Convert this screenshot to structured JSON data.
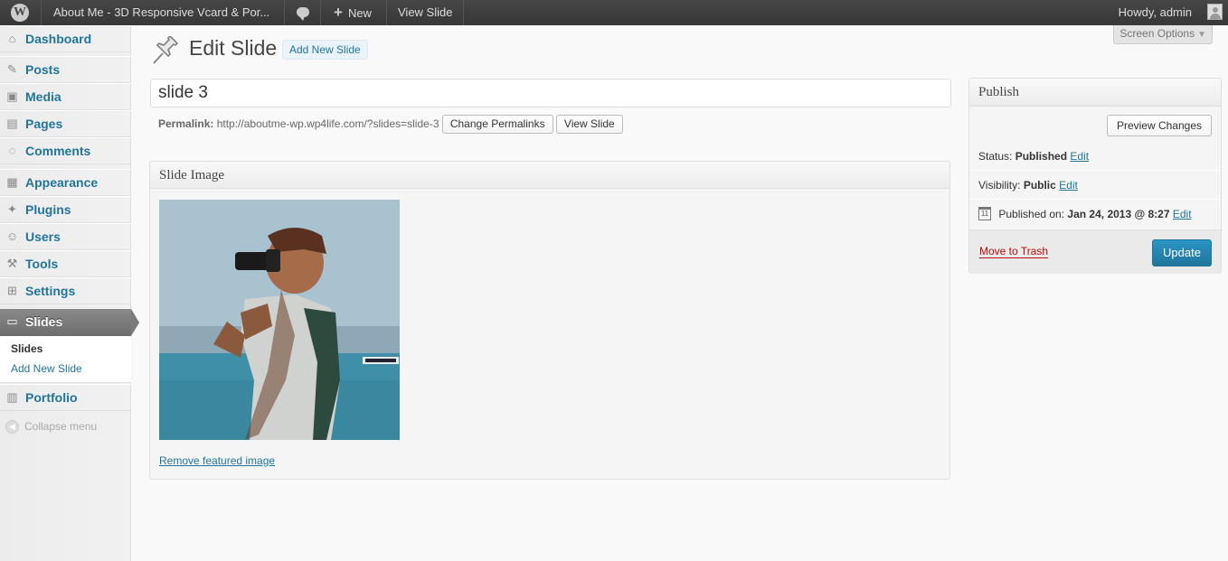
{
  "admin_bar": {
    "site_name": "About Me - 3D Responsive Vcard & Por...",
    "new_label": "New",
    "view_label": "View Slide",
    "howdy": "Howdy, admin"
  },
  "sidebar": {
    "items": [
      {
        "label": "Dashboard",
        "icon": "dashboard-icon"
      },
      {
        "label": "Posts",
        "icon": "pushpin-icon"
      },
      {
        "label": "Media",
        "icon": "media-icon"
      },
      {
        "label": "Pages",
        "icon": "pages-icon"
      },
      {
        "label": "Comments",
        "icon": "comments-icon"
      },
      {
        "label": "Appearance",
        "icon": "appearance-icon"
      },
      {
        "label": "Plugins",
        "icon": "plugins-icon"
      },
      {
        "label": "Users",
        "icon": "users-icon"
      },
      {
        "label": "Tools",
        "icon": "tools-icon"
      },
      {
        "label": "Settings",
        "icon": "settings-icon"
      },
      {
        "label": "Slides",
        "icon": "slides-icon"
      },
      {
        "label": "Portfolio",
        "icon": "portfolio-icon"
      }
    ],
    "submenu": {
      "current": "Slides",
      "add_new": "Add New Slide"
    },
    "collapse": "Collapse menu"
  },
  "header": {
    "title": "Edit Slide",
    "add_new": "Add New Slide",
    "screen_options": "Screen Options"
  },
  "editor": {
    "title_value": "slide 3",
    "permalink_label": "Permalink:",
    "permalink_url": "http://aboutme-wp.wp4life.com/?slides=slide-3",
    "change_permalinks": "Change Permalinks",
    "view_slide": "View Slide"
  },
  "slide_image": {
    "heading": "Slide Image",
    "remove": "Remove featured image"
  },
  "publish": {
    "heading": "Publish",
    "preview": "Preview Changes",
    "status_label": "Status:",
    "status_value": "Published",
    "visibility_label": "Visibility:",
    "visibility_value": "Public",
    "published_on_label": "Published on:",
    "published_on_value": "Jan 24, 2013 @ 8:27",
    "edit": "Edit",
    "trash": "Move to Trash",
    "update": "Update"
  },
  "colors": {
    "link": "#21759b",
    "admin_bar": "#464646",
    "update_button": "#21759b",
    "trash": "#bc0b0b"
  }
}
